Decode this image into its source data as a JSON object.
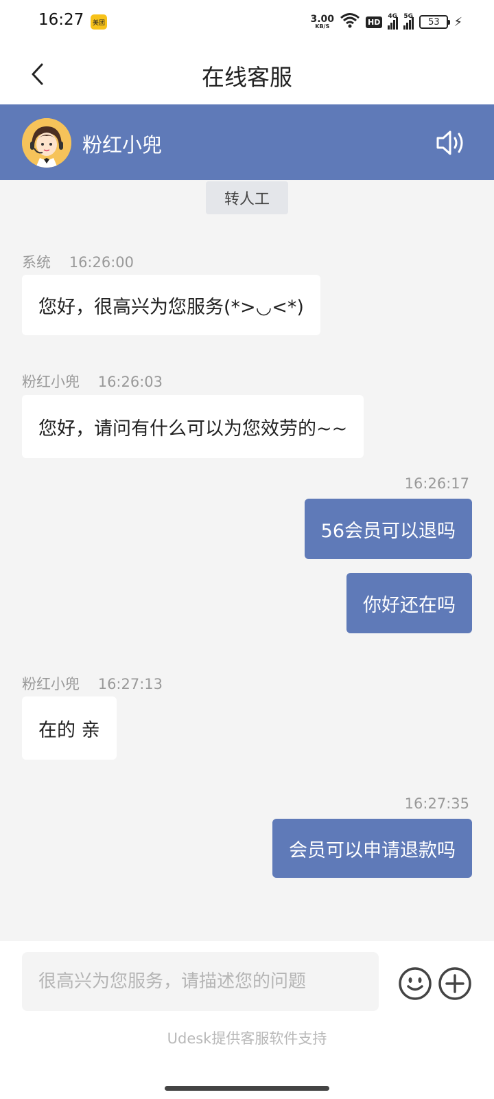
{
  "status_bar": {
    "time": "16:27",
    "app_badge": "美团",
    "net_speed_value": "3.00",
    "net_speed_unit": "KB/S",
    "hd_label": "HD",
    "signal1_label": "4G",
    "signal2_label": "5G",
    "battery": "53"
  },
  "nav": {
    "title": "在线客服"
  },
  "agent": {
    "name": "粉红小兜"
  },
  "transfer_label": "转人工",
  "messages": [
    {
      "side": "left",
      "sender": "系统",
      "time": "16:26:00",
      "text": "您好，很高兴为您服务(*>◡<*)"
    },
    {
      "side": "left",
      "sender": "粉红小兜",
      "time": "16:26:03",
      "text": "您好，请问有什么可以为您效劳的~~"
    },
    {
      "side": "right",
      "time": "16:26:17",
      "text": "56会员可以退吗"
    },
    {
      "side": "right",
      "text": "你好还在吗"
    },
    {
      "side": "left",
      "sender": "粉红小兜",
      "time": "16:27:13",
      "text": "在的 亲"
    },
    {
      "side": "right",
      "time": "16:27:35",
      "text": "会员可以申请退款吗"
    }
  ],
  "input": {
    "placeholder": "很高兴为您服务，请描述您的问题",
    "value": ""
  },
  "footer": {
    "powered_by": "Udesk提供客服软件支持"
  },
  "colors": {
    "accent": "#5f7ab8",
    "background": "#f4f4f4"
  }
}
